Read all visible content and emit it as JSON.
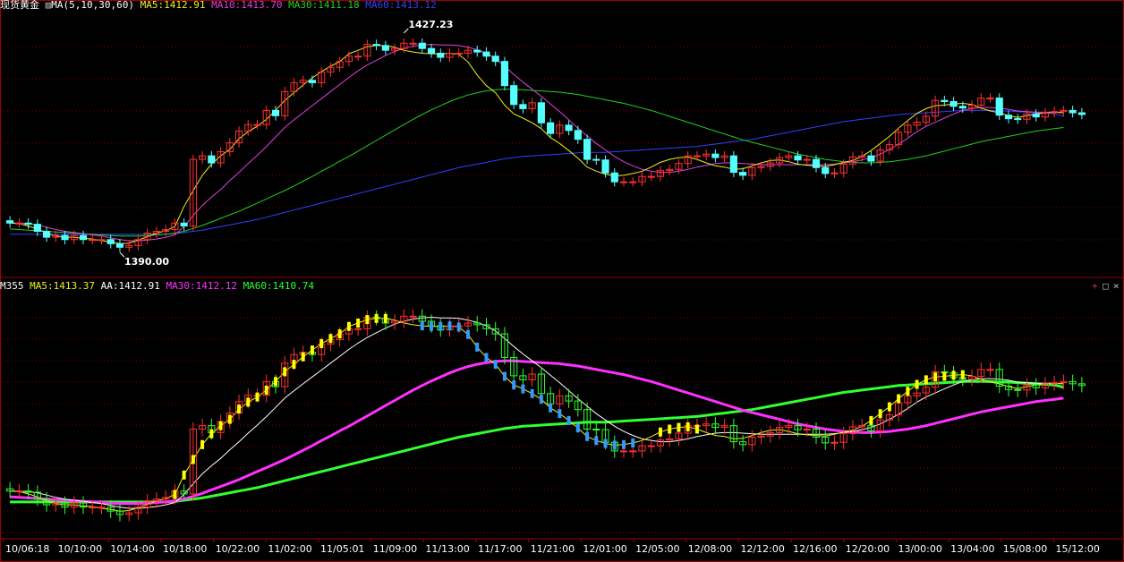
{
  "panels": {
    "top": {
      "title": "现货黄金",
      "indicator": "MA(5,10,30,60)",
      "legend": [
        {
          "text": "MA5:1412.91",
          "color": "#f0f020"
        },
        {
          "text": "MA10:1413.70",
          "color": "#e040e0"
        },
        {
          "text": "MA30:1411.18",
          "color": "#20d020"
        },
        {
          "text": "MA60:1413.12",
          "color": "#3040ff"
        }
      ],
      "annotations": {
        "high": "1427.23",
        "low": "1390.00"
      }
    },
    "bottom": {
      "name": "M355",
      "legend": [
        {
          "text": "MA5:1413.37",
          "color": "#f0f020"
        },
        {
          "text": "AA:1412.91",
          "color": "#ffffff"
        },
        {
          "text": "MA30:1412.12",
          "color": "#ff30ff"
        },
        {
          "text": "MA60:1410.74",
          "color": "#30ff30"
        }
      ]
    }
  },
  "controls": {
    "add": "+",
    "restore": "□",
    "close": "×"
  },
  "chart_data": {
    "type": "candlestick",
    "x_ticks": [
      "10/06:18",
      "10/10:00",
      "10/14:00",
      "10/18:00",
      "10/22:00",
      "11/02:00",
      "11/05:01",
      "11/09:00",
      "11/13:00",
      "11/17:00",
      "11/21:00",
      "12/01:00",
      "12/05:00",
      "12/08:00",
      "12/12:00",
      "12/16:00",
      "12/20:00",
      "13/00:00",
      "13/04:00",
      "15/08:00",
      "15/12:00"
    ],
    "close": [
      1395.0,
      1395.0,
      1394.8,
      1393.6,
      1392.6,
      1392.9,
      1392.2,
      1392.9,
      1392.2,
      1392.2,
      1392.2,
      1391.5,
      1390.9,
      1391.2,
      1392.2,
      1393.3,
      1393.6,
      1393.9,
      1395.0,
      1394.5,
      1405.8,
      1406.4,
      1405.2,
      1407.1,
      1408.6,
      1410.6,
      1411.7,
      1411.7,
      1414.1,
      1413.2,
      1417.3,
      1418.8,
      1419.2,
      1418.8,
      1420.6,
      1421.4,
      1422.4,
      1423.3,
      1423.3,
      1425.3,
      1425.1,
      1424.3,
      1424.6,
      1425.5,
      1425.5,
      1424.6,
      1423.8,
      1423.1,
      1423.8,
      1423.8,
      1424.3,
      1424.0,
      1423.3,
      1422.4,
      1418.3,
      1415.1,
      1414.4,
      1415.4,
      1412.0,
      1410.2,
      1411.6,
      1410.7,
      1409.2,
      1405.8,
      1405.7,
      1403.5,
      1402.0,
      1402.0,
      1402.0,
      1402.9,
      1402.9,
      1403.9,
      1404.1,
      1405.1,
      1406.4,
      1406.4,
      1406.7,
      1406.1,
      1406.4,
      1403.6,
      1403.1,
      1404.4,
      1404.6,
      1405.2,
      1406.1,
      1406.4,
      1405.7,
      1405.8,
      1404.4,
      1403.4,
      1403.5,
      1405.0,
      1406.2,
      1406.4,
      1405.5,
      1407.4,
      1408.3,
      1410.4,
      1411.6,
      1412.1,
      1413.1,
      1415.8,
      1415.6,
      1414.8,
      1414.5,
      1415.0,
      1416.2,
      1416.2,
      1413.3,
      1412.7,
      1412.6,
      1413.5,
      1413.0,
      1413.7,
      1413.9,
      1414.1,
      1413.7,
      1413.4
    ],
    "ma5": [
      1395.0,
      1394.9,
      1394.5,
      1394.0,
      1393.3,
      1392.8,
      1392.6,
      1392.6,
      1392.4,
      1392.3,
      1392.0,
      1391.8,
      1391.5,
      1391.6,
      1392.1,
      1392.7,
      1393.3,
      1393.7,
      1394.4,
      1397.8,
      1400.5,
      1403.1,
      1405.0,
      1406.4,
      1407.5,
      1409.3,
      1410.5,
      1411.4,
      1412.6,
      1414.1,
      1415.8,
      1417.1,
      1418.4,
      1419.6,
      1420.7,
      1421.6,
      1422.4,
      1423.7,
      1424.3,
      1424.9,
      1425.1,
      1425.1,
      1424.8,
      1424.3,
      1424.0,
      1423.8,
      1423.7,
      1423.7,
      1423.8,
      1423.6,
      1422.3,
      1420.1,
      1418.3,
      1417.1,
      1415.0,
      1413.5,
      1412.8,
      1412.0,
      1411.0,
      1409.5,
      1408.5,
      1407.3,
      1406.0,
      1404.5,
      1403.8,
      1403.3,
      1403.0,
      1403.1,
      1403.4,
      1403.8,
      1404.5,
      1405.3,
      1405.8,
      1406.1,
      1406.2,
      1405.8,
      1405.2,
      1404.7,
      1404.5,
      1404.1,
      1404.2,
      1404.7,
      1405.2,
      1405.6,
      1405.7,
      1405.4,
      1405.0,
      1404.8,
      1404.7,
      1404.6,
      1404.9,
      1405.3,
      1405.6,
      1406.3,
      1407.3,
      1408.5,
      1409.7,
      1411.1,
      1412.4,
      1413.6,
      1414.4,
      1414.9,
      1415.0,
      1415.2,
      1415.3,
      1415.1,
      1414.5,
      1414.0,
      1413.7,
      1413.2,
      1412.9,
      1413.2,
      1413.5,
      1413.7,
      1413.8,
      1413.7
    ],
    "ma10": [
      1395.0,
      1395.0,
      1394.9,
      1394.7,
      1394.3,
      1393.9,
      1393.6,
      1393.4,
      1393.2,
      1393.0,
      1392.8,
      1392.5,
      1392.2,
      1392.0,
      1392.0,
      1392.1,
      1392.3,
      1392.6,
      1393.0,
      1394.4,
      1396.3,
      1398.0,
      1399.4,
      1400.7,
      1402.2,
      1403.6,
      1405.1,
      1406.5,
      1408.0,
      1409.6,
      1411.2,
      1412.5,
      1413.7,
      1414.9,
      1416.1,
      1417.3,
      1418.5,
      1419.7,
      1420.8,
      1421.8,
      1422.6,
      1423.4,
      1424.1,
      1424.6,
      1425.0,
      1425.2,
      1425.3,
      1425.2,
      1425.2,
      1425.1,
      1424.8,
      1424.4,
      1423.8,
      1422.9,
      1421.6,
      1420.2,
      1418.9,
      1417.7,
      1416.5,
      1415.2,
      1413.9,
      1412.5,
      1411.1,
      1409.8,
      1408.5,
      1407.4,
      1406.3,
      1405.4,
      1404.7,
      1404.1,
      1403.8,
      1403.6,
      1403.6,
      1403.8,
      1404.1,
      1404.5,
      1404.8,
      1405.1,
      1405.2,
      1405.2,
      1405.1,
      1405.0,
      1404.9,
      1404.9,
      1404.9,
      1404.9,
      1404.9,
      1404.9,
      1404.9,
      1404.9,
      1405.0,
      1405.2,
      1405.4,
      1405.7,
      1406.1,
      1406.7,
      1407.5,
      1408.4,
      1409.4,
      1410.5,
      1411.4,
      1412.1,
      1412.8,
      1413.5,
      1414.1,
      1414.4,
      1414.6,
      1414.6,
      1414.5,
      1414.3,
      1414.0,
      1413.9,
      1413.8,
      1413.8,
      1413.8,
      1413.7
    ],
    "ma30": [
      1394.0,
      1393.9,
      1393.8,
      1393.7,
      1393.6,
      1393.5,
      1393.4,
      1393.3,
      1393.2,
      1393.1,
      1393.0,
      1392.9,
      1392.8,
      1392.8,
      1392.8,
      1392.9,
      1393.0,
      1393.1,
      1393.3,
      1393.6,
      1394.1,
      1394.6,
      1395.2,
      1395.8,
      1396.4,
      1397.0,
      1397.7,
      1398.4,
      1399.1,
      1399.8,
      1400.5,
      1401.3,
      1402.1,
      1402.9,
      1403.8,
      1404.6,
      1405.5,
      1406.3,
      1407.2,
      1408.1,
      1409.0,
      1409.9,
      1410.8,
      1411.7,
      1412.6,
      1413.4,
      1414.2,
      1414.9,
      1415.6,
      1416.2,
      1416.7,
      1417.1,
      1417.4,
      1417.6,
      1417.7,
      1417.7,
      1417.6,
      1417.5,
      1417.4,
      1417.3,
      1417.2,
      1417.0,
      1416.8,
      1416.5,
      1416.2,
      1415.9,
      1415.6,
      1415.3,
      1414.9,
      1414.5,
      1414.1,
      1413.6,
      1413.1,
      1412.6,
      1412.1,
      1411.6,
      1411.1,
      1410.6,
      1410.1,
      1409.6,
      1409.1,
      1408.7,
      1408.3,
      1407.9,
      1407.5,
      1407.1,
      1406.7,
      1406.4,
      1406.1,
      1405.8,
      1405.6,
      1405.4,
      1405.3,
      1405.2,
      1405.2,
      1405.3,
      1405.4,
      1405.6,
      1405.8,
      1406.1,
      1406.4,
      1406.8,
      1407.2,
      1407.6,
      1408.0,
      1408.4,
      1408.8,
      1409.1,
      1409.4,
      1409.7,
      1410.0,
      1410.3,
      1410.6,
      1410.8,
      1411.0,
      1411.2
    ],
    "ma60": [
      1393.1,
      1393.1,
      1393.1,
      1393.1,
      1393.1,
      1393.1,
      1393.1,
      1393.1,
      1393.1,
      1393.1,
      1393.1,
      1393.1,
      1393.1,
      1393.1,
      1393.1,
      1393.1,
      1393.1,
      1393.1,
      1393.2,
      1393.4,
      1393.6,
      1393.8,
      1394.1,
      1394.4,
      1394.7,
      1395.0,
      1395.3,
      1395.6,
      1396.0,
      1396.4,
      1396.8,
      1397.2,
      1397.6,
      1398.0,
      1398.4,
      1398.8,
      1399.2,
      1399.6,
      1400.0,
      1400.4,
      1400.8,
      1401.2,
      1401.6,
      1402.0,
      1402.4,
      1402.8,
      1403.2,
      1403.6,
      1404.0,
      1404.4,
      1404.7,
      1405.0,
      1405.3,
      1405.6,
      1405.9,
      1406.1,
      1406.3,
      1406.4,
      1406.5,
      1406.6,
      1406.7,
      1406.8,
      1406.9,
      1407.0,
      1407.0,
      1407.0,
      1407.1,
      1407.2,
      1407.3,
      1407.4,
      1407.5,
      1407.6,
      1407.7,
      1407.8,
      1407.9,
      1408.0,
      1408.2,
      1408.4,
      1408.6,
      1408.8,
      1409.0,
      1409.2,
      1409.5,
      1409.8,
      1410.1,
      1410.4,
      1410.7,
      1411.0,
      1411.3,
      1411.6,
      1411.9,
      1412.2,
      1412.4,
      1412.6,
      1412.8,
      1413.0,
      1413.2,
      1413.4,
      1413.5,
      1413.6,
      1413.7,
      1413.8,
      1413.9,
      1414.0,
      1414.1,
      1414.1,
      1414.1,
      1414.1,
      1414.0,
      1414.0,
      1413.9,
      1413.8,
      1413.7,
      1413.6,
      1413.5,
      1413.1
    ],
    "annotations": [
      {
        "label": "1427.23",
        "value": 1427.23
      },
      {
        "label": "1390.00",
        "value": 1390.0
      }
    ],
    "price_range": [
      1387,
      1431
    ]
  }
}
